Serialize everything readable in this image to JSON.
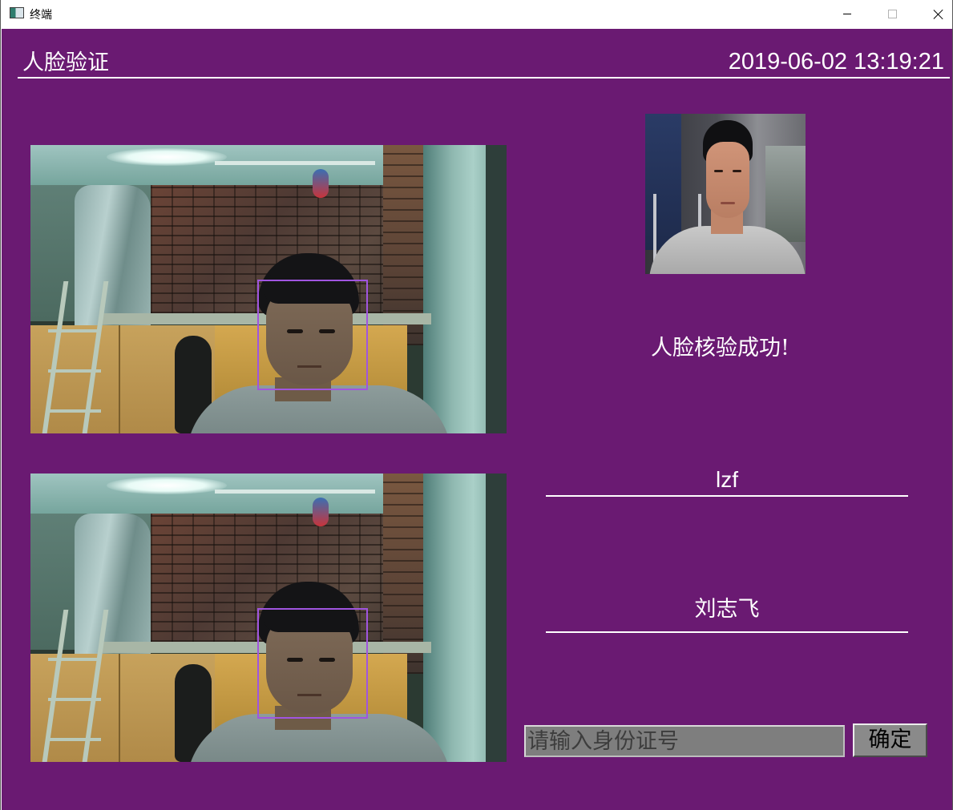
{
  "window": {
    "title": "终端",
    "controls": {
      "minimize": "minimize-icon",
      "maximize": "maximize-icon",
      "close": "close-icon"
    }
  },
  "header": {
    "title": "人脸验证",
    "datetime": "2019-06-02 13:19:21"
  },
  "colors": {
    "background": "#6a1a72",
    "text": "#ffffff",
    "face_box": "#a055e0",
    "input_bg": "#7e7e7e",
    "button_bg": "#8a8a8a"
  },
  "verification": {
    "status": "人脸核验成功!",
    "username": "lzf",
    "name": "刘志飞"
  },
  "id_entry": {
    "value": "",
    "placeholder": "请输入身份证号",
    "confirm_label": "确定"
  }
}
